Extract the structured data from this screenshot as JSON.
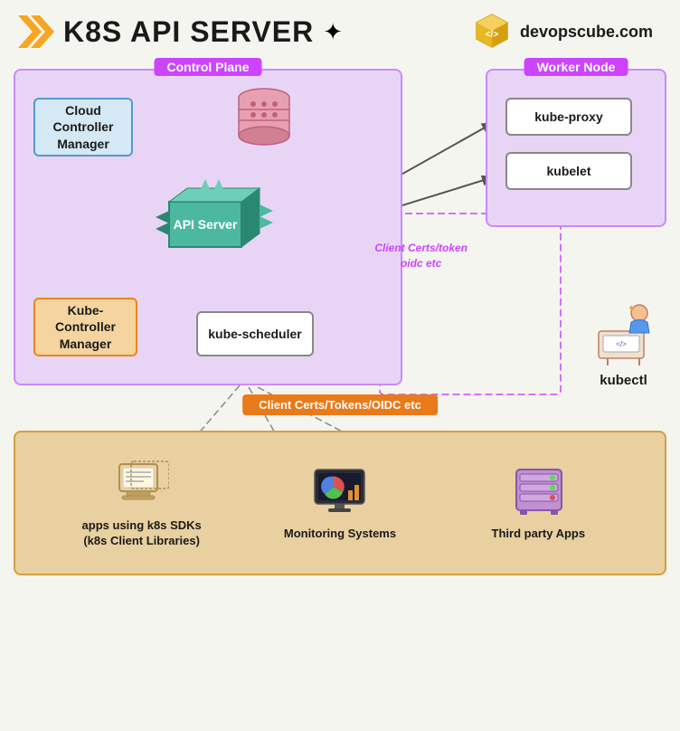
{
  "header": {
    "title": "K8S API SERVER",
    "domain": "devopscube.com"
  },
  "diagram": {
    "control_plane_label": "Control Plane",
    "worker_node_label": "Worker Node",
    "components": {
      "cloud_controller": "Cloud Controller\nManager",
      "kube_controller": "Kube-Controller\nManager",
      "kube_scheduler": "kube-scheduler",
      "kube_proxy": "kube-proxy",
      "kubelet": "kubelet",
      "api_server": "API Server",
      "kubectl": "kubectl"
    },
    "labels": {
      "client_certs_inner": "Client Certs/token\noidc etc",
      "client_certs_banner": "Client Certs/Tokens/OIDC etc"
    },
    "bottom_apps": [
      {
        "label": "apps using k8s SDKs\n(k8s Client Libraries)",
        "icon": "apps-sdk-icon"
      },
      {
        "label": "Monitoring Systems",
        "icon": "monitoring-icon"
      },
      {
        "label": "Third party Apps",
        "icon": "third-party-icon"
      }
    ]
  }
}
